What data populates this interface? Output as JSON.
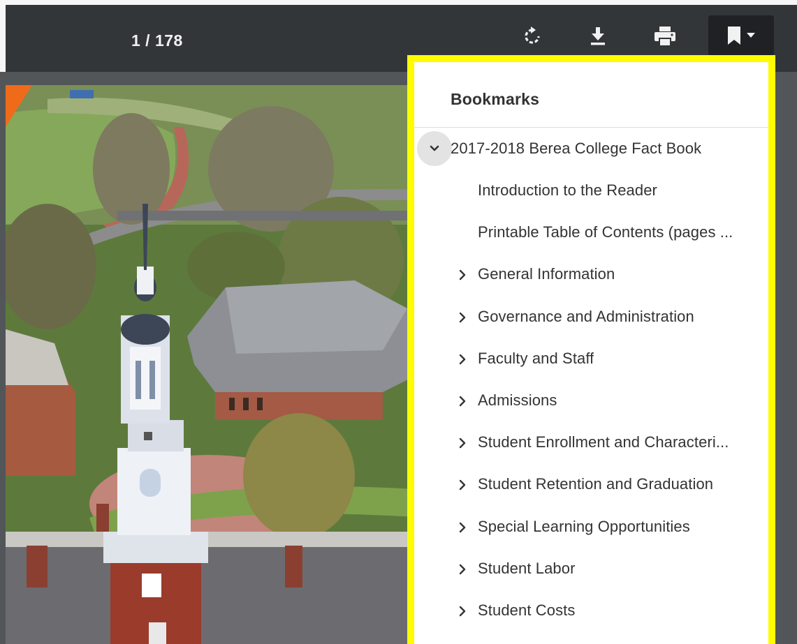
{
  "toolbar": {
    "page_current": "1",
    "page_separator": " / ",
    "page_total": "178",
    "icons": [
      "rotate-icon",
      "download-icon",
      "print-icon",
      "bookmark-icon",
      "caret-down-icon"
    ]
  },
  "bookmarks": {
    "title": "Bookmarks",
    "root": {
      "label": "2017-2018 Berea College Fact Book",
      "expanded": true
    },
    "items": [
      {
        "label": "Introduction to the Reader",
        "has_children": false
      },
      {
        "label": "Printable Table of Contents (pages ...",
        "has_children": false
      },
      {
        "label": "General Information",
        "has_children": true
      },
      {
        "label": "Governance and Administration",
        "has_children": true
      },
      {
        "label": "Faculty and Staff",
        "has_children": true
      },
      {
        "label": "Admissions",
        "has_children": true
      },
      {
        "label": "Student Enrollment and Characteri...",
        "has_children": true
      },
      {
        "label": "Student Retention and Graduation",
        "has_children": true
      },
      {
        "label": "Special Learning Opportunities",
        "has_children": true
      },
      {
        "label": "Student Labor",
        "has_children": true
      },
      {
        "label": "Student Costs",
        "has_children": true
      }
    ]
  },
  "colors": {
    "toolbar_bg": "#323639",
    "viewer_bg": "#525659",
    "highlight_border": "#fffc00",
    "accent_orange": "#ef6b1a"
  }
}
